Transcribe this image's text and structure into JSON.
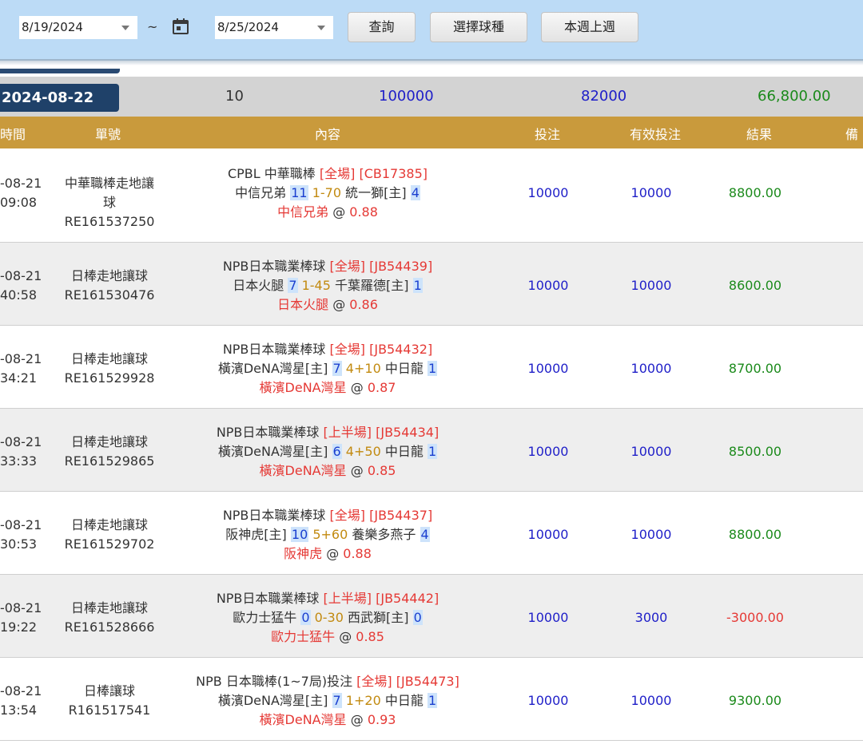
{
  "filters": {
    "start_date": "8/19/2024",
    "separator": "~",
    "end_date": "8/25/2024",
    "query_label": "查詢",
    "choose_sport_label": "選擇球種",
    "week_label": "本週上週"
  },
  "summary": {
    "date": "2024-08-22",
    "count": "10",
    "total_stake": "100000",
    "total_valid": "82000",
    "total_result": "66,800.00"
  },
  "columns": {
    "time": "時間",
    "ticket": "單號",
    "content": "內容",
    "stake": "投注",
    "valid": "有效投注",
    "result": "結果",
    "remark": "備"
  },
  "rows": [
    {
      "date": "-08-21",
      "time": "09:08",
      "type_lines": [
        "中華職棒走地讓",
        "球"
      ],
      "ticket": "RE161537250",
      "league": "CPBL 中華職棒",
      "period": "[全場]",
      "code": "[CB17385]",
      "home_team": "中信兄弟",
      "home_score": "11",
      "line": "1-70",
      "away_team": "統一獅[主]",
      "away_score": "4",
      "pick": "中信兄弟",
      "at": "@",
      "odds": "0.88",
      "stake": "10000",
      "valid": "10000",
      "result": "8800.00"
    },
    {
      "date": "-08-21",
      "time": "40:58",
      "type_lines": [
        "日棒走地讓球"
      ],
      "ticket": "RE161530476",
      "league": "NPB日本職業棒球",
      "period": "[全場]",
      "code": "[JB54439]",
      "home_team": "日本火腿",
      "home_score": "7",
      "line": "1-45",
      "away_team": "千葉羅德[主]",
      "away_score": "1",
      "pick": "日本火腿",
      "at": "@",
      "odds": "0.86",
      "stake": "10000",
      "valid": "10000",
      "result": "8600.00"
    },
    {
      "date": "-08-21",
      "time": "34:21",
      "type_lines": [
        "日棒走地讓球"
      ],
      "ticket": "RE161529928",
      "league": "NPB日本職業棒球",
      "period": "[全場]",
      "code": "[JB54432]",
      "home_team": "橫濱DeNA灣星[主]",
      "home_score": "7",
      "line": "4+10",
      "away_team": "中日龍",
      "away_score": "1",
      "pick": "橫濱DeNA灣星",
      "at": "@",
      "odds": "0.87",
      "stake": "10000",
      "valid": "10000",
      "result": "8700.00"
    },
    {
      "date": "-08-21",
      "time": "33:33",
      "type_lines": [
        "日棒走地讓球"
      ],
      "ticket": "RE161529865",
      "league": "NPB日本職業棒球",
      "period": "[上半場]",
      "code": "[JB54434]",
      "home_team": "橫濱DeNA灣星[主]",
      "home_score": "6",
      "line": "4+50",
      "away_team": "中日龍",
      "away_score": "1",
      "pick": "橫濱DeNA灣星",
      "at": "@",
      "odds": "0.85",
      "stake": "10000",
      "valid": "10000",
      "result": "8500.00"
    },
    {
      "date": "-08-21",
      "time": "30:53",
      "type_lines": [
        "日棒走地讓球"
      ],
      "ticket": "RE161529702",
      "league": "NPB日本職業棒球",
      "period": "[全場]",
      "code": "[JB54437]",
      "home_team": "阪神虎[主]",
      "home_score": "10",
      "line": "5+60",
      "away_team": "養樂多燕子",
      "away_score": "4",
      "pick": "阪神虎",
      "at": "@",
      "odds": "0.88",
      "stake": "10000",
      "valid": "10000",
      "result": "8800.00"
    },
    {
      "date": "-08-21",
      "time": "19:22",
      "type_lines": [
        "日棒走地讓球"
      ],
      "ticket": "RE161528666",
      "league": "NPB日本職業棒球",
      "period": "[上半場]",
      "code": "[JB54442]",
      "home_team": "歐力士猛牛",
      "home_score": "0",
      "line": "0-30",
      "away_team": "西武獅[主]",
      "away_score": "0",
      "pick": "歐力士猛牛",
      "at": "@",
      "odds": "0.85",
      "stake": "10000",
      "valid": "3000",
      "result": "-3000.00"
    },
    {
      "date": "-08-21",
      "time": "13:54",
      "type_lines": [
        "日棒讓球"
      ],
      "ticket": "R161517541",
      "league": "NPB 日本職棒(1~7局)投注",
      "period": "[全場]",
      "code": "[JB54473]",
      "home_team": "橫濱DeNA灣星[主]",
      "home_score": "7",
      "line": "1+20",
      "away_team": "中日龍",
      "away_score": "1",
      "pick": "橫濱DeNA灣星",
      "at": "@",
      "odds": "0.93",
      "stake": "10000",
      "valid": "10000",
      "result": "9300.00"
    }
  ],
  "colors": {
    "toolbar_bg": "#bcdbf6",
    "header_bg": "#c99a3c",
    "summary_date_bg": "#1f4169",
    "positive": "#1b8a1b",
    "negative": "#e53935",
    "amount_blue": "#1e1ec8"
  },
  "icons": {
    "date_picker": "calendar-icon",
    "dropdown": "chevron-down-icon"
  }
}
